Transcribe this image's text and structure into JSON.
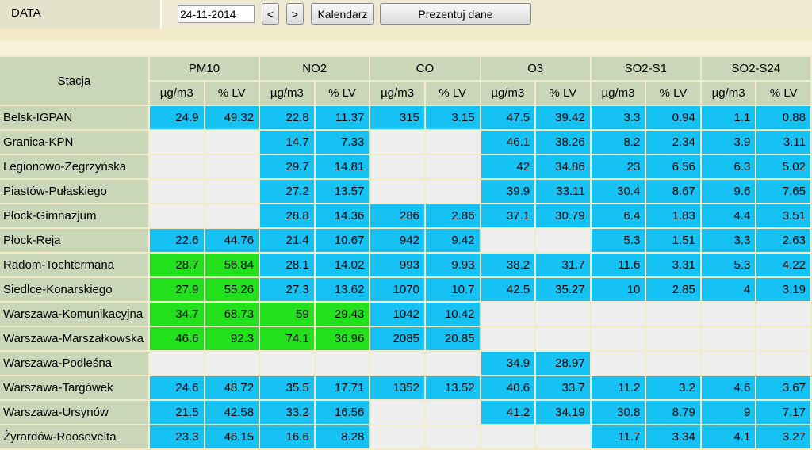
{
  "toolbar": {
    "date_label": "DATA",
    "date_value": "24-11-2014",
    "prev_label": "<",
    "next_label": ">",
    "calendar_label": "Kalendarz",
    "present_label": "Prezentuj dane"
  },
  "table": {
    "station_header": "Stacja",
    "pollutants": [
      "PM10",
      "NO2",
      "CO",
      "O3",
      "SO2-S1",
      "SO2-S24"
    ],
    "unit_headers": [
      "µg/m3",
      "% LV"
    ],
    "colors": {
      "normal": "#16c2f4",
      "elevated": "#22e01c",
      "no_data": "#eeeeee"
    },
    "rows": [
      {
        "station": "Belsk-IGPAN",
        "cells": [
          [
            "24.9",
            "b"
          ],
          [
            "49.32",
            "b"
          ],
          [
            "22.8",
            "b"
          ],
          [
            "11.37",
            "b"
          ],
          [
            "315",
            "b"
          ],
          [
            "3.15",
            "b"
          ],
          [
            "47.5",
            "b"
          ],
          [
            "39.42",
            "b"
          ],
          [
            "3.3",
            "b"
          ],
          [
            "0.94",
            "b"
          ],
          [
            "1.1",
            "b"
          ],
          [
            "0.88",
            "b"
          ]
        ]
      },
      {
        "station": "Granica-KPN",
        "cells": [
          [
            "",
            "e"
          ],
          [
            "",
            "e"
          ],
          [
            "14.7",
            "b"
          ],
          [
            "7.33",
            "b"
          ],
          [
            "",
            "e"
          ],
          [
            "",
            "e"
          ],
          [
            "46.1",
            "b"
          ],
          [
            "38.26",
            "b"
          ],
          [
            "8.2",
            "b"
          ],
          [
            "2.34",
            "b"
          ],
          [
            "3.9",
            "b"
          ],
          [
            "3.11",
            "b"
          ]
        ]
      },
      {
        "station": "Legionowo-Zegrzyńska",
        "cells": [
          [
            "",
            "e"
          ],
          [
            "",
            "e"
          ],
          [
            "29.7",
            "b"
          ],
          [
            "14.81",
            "b"
          ],
          [
            "",
            "e"
          ],
          [
            "",
            "e"
          ],
          [
            "42",
            "b"
          ],
          [
            "34.86",
            "b"
          ],
          [
            "23",
            "b"
          ],
          [
            "6.56",
            "b"
          ],
          [
            "6.3",
            "b"
          ],
          [
            "5.02",
            "b"
          ]
        ]
      },
      {
        "station": "Piastów-Pułaskiego",
        "cells": [
          [
            "",
            "e"
          ],
          [
            "",
            "e"
          ],
          [
            "27.2",
            "b"
          ],
          [
            "13.57",
            "b"
          ],
          [
            "",
            "e"
          ],
          [
            "",
            "e"
          ],
          [
            "39.9",
            "b"
          ],
          [
            "33.11",
            "b"
          ],
          [
            "30.4",
            "b"
          ],
          [
            "8.67",
            "b"
          ],
          [
            "9.6",
            "b"
          ],
          [
            "7.65",
            "b"
          ]
        ]
      },
      {
        "station": "Płock-Gimnazjum",
        "cells": [
          [
            "",
            "e"
          ],
          [
            "",
            "e"
          ],
          [
            "28.8",
            "b"
          ],
          [
            "14.36",
            "b"
          ],
          [
            "286",
            "b"
          ],
          [
            "2.86",
            "b"
          ],
          [
            "37.1",
            "b"
          ],
          [
            "30.79",
            "b"
          ],
          [
            "6.4",
            "b"
          ],
          [
            "1.83",
            "b"
          ],
          [
            "4.4",
            "b"
          ],
          [
            "3.51",
            "b"
          ]
        ]
      },
      {
        "station": "Płock-Reja",
        "cells": [
          [
            "22.6",
            "b"
          ],
          [
            "44.76",
            "b"
          ],
          [
            "21.4",
            "b"
          ],
          [
            "10.67",
            "b"
          ],
          [
            "942",
            "b"
          ],
          [
            "9.42",
            "b"
          ],
          [
            "",
            "e"
          ],
          [
            "",
            "e"
          ],
          [
            "5.3",
            "b"
          ],
          [
            "1.51",
            "b"
          ],
          [
            "3.3",
            "b"
          ],
          [
            "2.63",
            "b"
          ]
        ]
      },
      {
        "station": "Radom-Tochtermana",
        "cells": [
          [
            "28.7",
            "g"
          ],
          [
            "56.84",
            "g"
          ],
          [
            "28.1",
            "b"
          ],
          [
            "14.02",
            "b"
          ],
          [
            "993",
            "b"
          ],
          [
            "9.93",
            "b"
          ],
          [
            "38.2",
            "b"
          ],
          [
            "31.7",
            "b"
          ],
          [
            "11.6",
            "b"
          ],
          [
            "3.31",
            "b"
          ],
          [
            "5.3",
            "b"
          ],
          [
            "4.22",
            "b"
          ]
        ]
      },
      {
        "station": "Siedlce-Konarskiego",
        "cells": [
          [
            "27.9",
            "g"
          ],
          [
            "55.26",
            "g"
          ],
          [
            "27.3",
            "b"
          ],
          [
            "13.62",
            "b"
          ],
          [
            "1070",
            "b"
          ],
          [
            "10.7",
            "b"
          ],
          [
            "42.5",
            "b"
          ],
          [
            "35.27",
            "b"
          ],
          [
            "10",
            "b"
          ],
          [
            "2.85",
            "b"
          ],
          [
            "4",
            "b"
          ],
          [
            "3.19",
            "b"
          ]
        ]
      },
      {
        "station": "Warszawa-Komunikacyjna",
        "cells": [
          [
            "34.7",
            "g"
          ],
          [
            "68.73",
            "g"
          ],
          [
            "59",
            "g"
          ],
          [
            "29.43",
            "g"
          ],
          [
            "1042",
            "b"
          ],
          [
            "10.42",
            "b"
          ],
          [
            "",
            "e"
          ],
          [
            "",
            "e"
          ],
          [
            "",
            "e"
          ],
          [
            "",
            "e"
          ],
          [
            "",
            "e"
          ],
          [
            "",
            "e"
          ]
        ]
      },
      {
        "station": "Warszawa-Marszałkowska",
        "cells": [
          [
            "46.6",
            "g"
          ],
          [
            "92.3",
            "g"
          ],
          [
            "74.1",
            "g"
          ],
          [
            "36.96",
            "g"
          ],
          [
            "2085",
            "b"
          ],
          [
            "20.85",
            "b"
          ],
          [
            "",
            "e"
          ],
          [
            "",
            "e"
          ],
          [
            "",
            "e"
          ],
          [
            "",
            "e"
          ],
          [
            "",
            "e"
          ],
          [
            "",
            "e"
          ]
        ]
      },
      {
        "station": "Warszawa-Podleśna",
        "cells": [
          [
            "",
            "e"
          ],
          [
            "",
            "e"
          ],
          [
            "",
            "e"
          ],
          [
            "",
            "e"
          ],
          [
            "",
            "e"
          ],
          [
            "",
            "e"
          ],
          [
            "34.9",
            "b"
          ],
          [
            "28.97",
            "b"
          ],
          [
            "",
            "e"
          ],
          [
            "",
            "e"
          ],
          [
            "",
            "e"
          ],
          [
            "",
            "e"
          ]
        ]
      },
      {
        "station": "Warszawa-Targówek",
        "cells": [
          [
            "24.6",
            "b"
          ],
          [
            "48.72",
            "b"
          ],
          [
            "35.5",
            "b"
          ],
          [
            "17.71",
            "b"
          ],
          [
            "1352",
            "b"
          ],
          [
            "13.52",
            "b"
          ],
          [
            "40.6",
            "b"
          ],
          [
            "33.7",
            "b"
          ],
          [
            "11.2",
            "b"
          ],
          [
            "3.2",
            "b"
          ],
          [
            "4.6",
            "b"
          ],
          [
            "3.67",
            "b"
          ]
        ]
      },
      {
        "station": "Warszawa-Ursynów",
        "cells": [
          [
            "21.5",
            "b"
          ],
          [
            "42.58",
            "b"
          ],
          [
            "33.2",
            "b"
          ],
          [
            "16.56",
            "b"
          ],
          [
            "",
            "e"
          ],
          [
            "",
            "e"
          ],
          [
            "41.2",
            "b"
          ],
          [
            "34.19",
            "b"
          ],
          [
            "30.8",
            "b"
          ],
          [
            "8.79",
            "b"
          ],
          [
            "9",
            "b"
          ],
          [
            "7.17",
            "b"
          ]
        ]
      },
      {
        "station": "Żyrardów-Roosevelta",
        "cells": [
          [
            "23.3",
            "b"
          ],
          [
            "46.15",
            "b"
          ],
          [
            "16.6",
            "b"
          ],
          [
            "8.28",
            "b"
          ],
          [
            "",
            "e"
          ],
          [
            "",
            "e"
          ],
          [
            "",
            "e"
          ],
          [
            "",
            "e"
          ],
          [
            "11.7",
            "b"
          ],
          [
            "3.34",
            "b"
          ],
          [
            "4.1",
            "b"
          ],
          [
            "3.27",
            "b"
          ]
        ]
      }
    ]
  }
}
